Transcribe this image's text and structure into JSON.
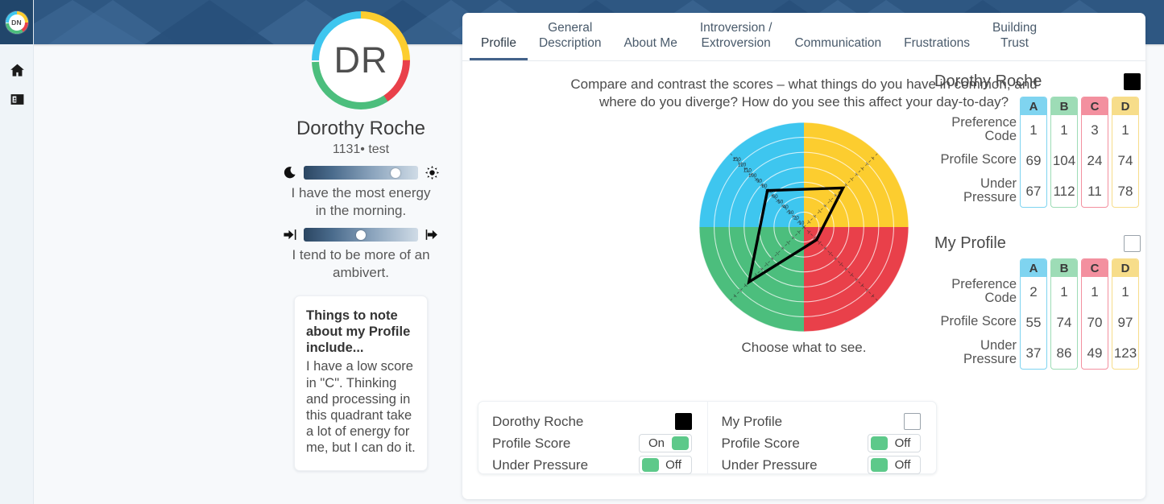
{
  "brand": {
    "logo_initials": "DN",
    "banner_color": "#2e5782",
    "rail_top_color": "#21466b"
  },
  "rail": {
    "items": [
      {
        "icon": "home-icon",
        "label": "Home"
      },
      {
        "icon": "contact-card-icon",
        "label": "Profile Card"
      }
    ]
  },
  "profile": {
    "initials": "DR",
    "name": "Dorothy Roche",
    "subtitle": "1131• test",
    "sliders": [
      {
        "name": "energy-slider",
        "left_icon": "moon-icon",
        "right_icon": "sun-icon",
        "value_pct": 80,
        "caption": "I have the most energy in the morning."
      },
      {
        "name": "introversion-slider",
        "left_icon": "arrow-in-icon",
        "right_icon": "arrow-out-icon",
        "value_pct": 50,
        "caption": "I tend to be more of an ambivert."
      }
    ],
    "note": {
      "title": "Things to note about my Profile include...",
      "body": "I have a low score in \"C\". Thinking and processing in this quadrant take a lot of energy for me, but I can do it."
    }
  },
  "tabs": [
    {
      "label": "Profile",
      "active": true
    },
    {
      "label": "General\nDescription",
      "active": false
    },
    {
      "label": "About Me",
      "active": false
    },
    {
      "label": "Introversion /\nExtroversion",
      "active": false
    },
    {
      "label": "Communication",
      "active": false
    },
    {
      "label": "Frustrations",
      "active": false
    },
    {
      "label": "Building\nTrust",
      "active": false
    }
  ],
  "main": {
    "question": "Compare and contrast the scores – what things do you have in common, and where do you diverge? How do you see this affect your day-to-day?",
    "choose_label": "Choose what to see."
  },
  "legend": {
    "left": {
      "name": "Dorothy Roche",
      "swatch": "filled",
      "rows": [
        {
          "label": "Profile Score",
          "state": "On"
        },
        {
          "label": "Under Pressure",
          "state": "Off"
        }
      ]
    },
    "right": {
      "name": "My Profile",
      "swatch": "empty",
      "rows": [
        {
          "label": "Profile Score",
          "state": "Off"
        },
        {
          "label": "Under Pressure",
          "state": "Off"
        }
      ]
    }
  },
  "scores": {
    "row_labels": [
      "Preference Code",
      "Profile Score",
      "Under Pressure"
    ],
    "columns": [
      "A",
      "B",
      "C",
      "D"
    ],
    "column_colors": [
      "#7fd4f0",
      "#9ddcb6",
      "#f3909f",
      "#f7dd8a"
    ],
    "blocks": [
      {
        "title": "Dorothy Roche",
        "swatch": "filled",
        "preference_code": [
          1,
          1,
          3,
          1
        ],
        "profile_score": [
          69,
          104,
          24,
          74
        ],
        "under_pressure": [
          67,
          112,
          11,
          78
        ]
      },
      {
        "title": "My Profile",
        "swatch": "empty",
        "preference_code": [
          2,
          1,
          1,
          1
        ],
        "profile_score": [
          55,
          74,
          70,
          97
        ],
        "under_pressure": [
          37,
          86,
          49,
          123
        ]
      }
    ]
  },
  "chart_data": {
    "type": "line",
    "chart_kind": "polar-radar",
    "title": "",
    "axes": [
      "A",
      "B",
      "C",
      "D"
    ],
    "axis_angles_deg": [
      135,
      225,
      315,
      45
    ],
    "quadrants": [
      {
        "code": "A",
        "color": "#3ec6ef",
        "position": "top-left"
      },
      {
        "code": "D",
        "color": "#fccd2f",
        "position": "top-right"
      },
      {
        "code": "B",
        "color": "#4cbe7d",
        "position": "bottom-left"
      },
      {
        "code": "C",
        "color": "#e9404a",
        "position": "bottom-right"
      }
    ],
    "tick_labels": [
      10,
      20,
      30,
      40,
      50,
      60,
      70,
      80,
      90,
      100,
      110,
      120,
      130
    ],
    "tick_axis": "upper-left diagonal (A)",
    "rlim": [
      0,
      140
    ],
    "grid": true,
    "legend_position": "below",
    "series": [
      {
        "name": "Dorothy Roche – Profile Score",
        "visible": true,
        "color": "#000000",
        "values": {
          "A": 69,
          "B": 104,
          "C": 24,
          "D": 74
        }
      },
      {
        "name": "Dorothy Roche – Under Pressure",
        "visible": false,
        "color": "#000000",
        "values": {
          "A": 67,
          "B": 112,
          "C": 11,
          "D": 78
        }
      },
      {
        "name": "My Profile – Profile Score",
        "visible": false,
        "color": "#555555",
        "values": {
          "A": 55,
          "B": 74,
          "C": 70,
          "D": 97
        }
      },
      {
        "name": "My Profile – Under Pressure",
        "visible": false,
        "color": "#555555",
        "values": {
          "A": 37,
          "B": 86,
          "C": 49,
          "D": 123
        }
      }
    ]
  }
}
